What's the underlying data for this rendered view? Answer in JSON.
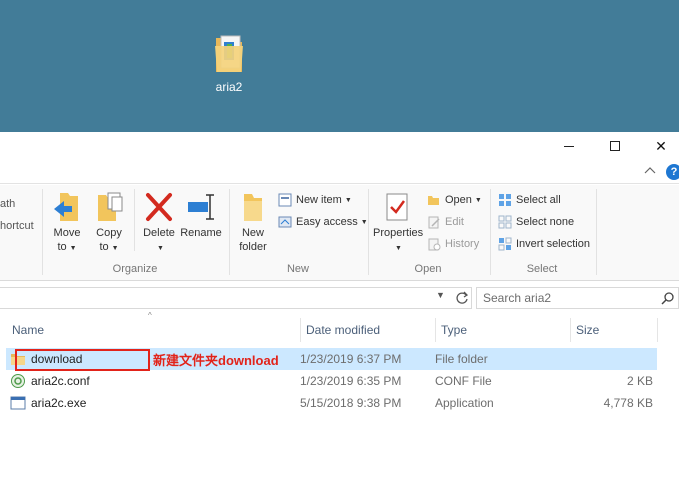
{
  "desktop": {
    "icon_label": "aria2"
  },
  "window": {
    "controls": {
      "minimize": "",
      "maximize": "",
      "close": "✕"
    },
    "help": "?"
  },
  "ribbon": {
    "clipped": {
      "path": "ath",
      "shortcut": "hortcut"
    },
    "organize": {
      "label": "Organize",
      "move_to": {
        "line1": "Move",
        "line2": "to"
      },
      "copy_to": {
        "line1": "Copy",
        "line2": "to"
      },
      "delete": "Delete",
      "rename": "Rename"
    },
    "new": {
      "label": "New",
      "new_folder": {
        "line1": "New",
        "line2": "folder"
      },
      "new_item": "New item",
      "easy_access": "Easy access"
    },
    "open": {
      "label": "Open",
      "properties": "Properties",
      "open": "Open",
      "edit": "Edit",
      "history": "History"
    },
    "select": {
      "label": "Select",
      "select_all": "Select all",
      "select_none": "Select none",
      "invert_selection": "Invert selection"
    }
  },
  "address": {
    "search_placeholder": "Search aria2"
  },
  "columns": {
    "name": "Name",
    "date": "Date modified",
    "type": "Type",
    "size": "Size"
  },
  "files": [
    {
      "name": "download",
      "date": "1/23/2019 6:37 PM",
      "type": "File folder",
      "size": ""
    },
    {
      "name": "aria2c.conf",
      "date": "1/23/2019 6:35 PM",
      "type": "CONF File",
      "size": "2 KB"
    },
    {
      "name": "aria2c.exe",
      "date": "5/15/2018 9:38 PM",
      "type": "Application",
      "size": "4,778 KB"
    }
  ],
  "annotation": {
    "text": "新建文件夹download"
  },
  "colors": {
    "desktop": "#427c98",
    "selection": "#cce8ff",
    "annotation": "#e2231a",
    "accent": "#1e77d2"
  }
}
